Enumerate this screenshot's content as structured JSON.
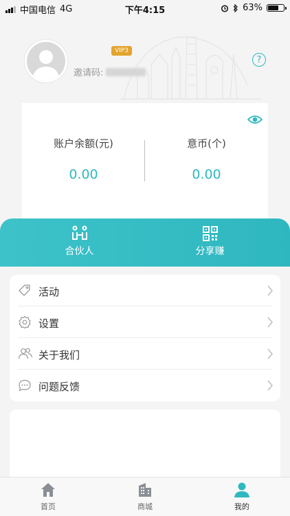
{
  "status_bar": {
    "carrier": "中国电信",
    "network": "4G",
    "time": "下午4:15",
    "battery": "63%",
    "battery_level": 0.63
  },
  "profile": {
    "vip_badge": "VIP3",
    "invite_label": "邀请码:"
  },
  "help": {
    "glyph": "?"
  },
  "balance": {
    "account_label": "账户余额(元)",
    "account_value": "0.00",
    "coin_label": "意币(个)",
    "coin_value": "0.00"
  },
  "actions": {
    "partner_label": "合伙人",
    "share_label": "分享赚"
  },
  "menu": [
    {
      "label": "活动",
      "icon": "tag-icon"
    },
    {
      "label": "设置",
      "icon": "gear-icon"
    },
    {
      "label": "关于我们",
      "icon": "people-icon"
    },
    {
      "label": "问题反馈",
      "icon": "chat-icon"
    }
  ],
  "tabs": [
    {
      "label": "首页",
      "icon": "home-icon"
    },
    {
      "label": "商城",
      "icon": "building-icon"
    },
    {
      "label": "我的",
      "icon": "user-icon",
      "active": true
    }
  ],
  "colors": {
    "accent": "#2fb8c0",
    "vip": "#e3a32e"
  }
}
